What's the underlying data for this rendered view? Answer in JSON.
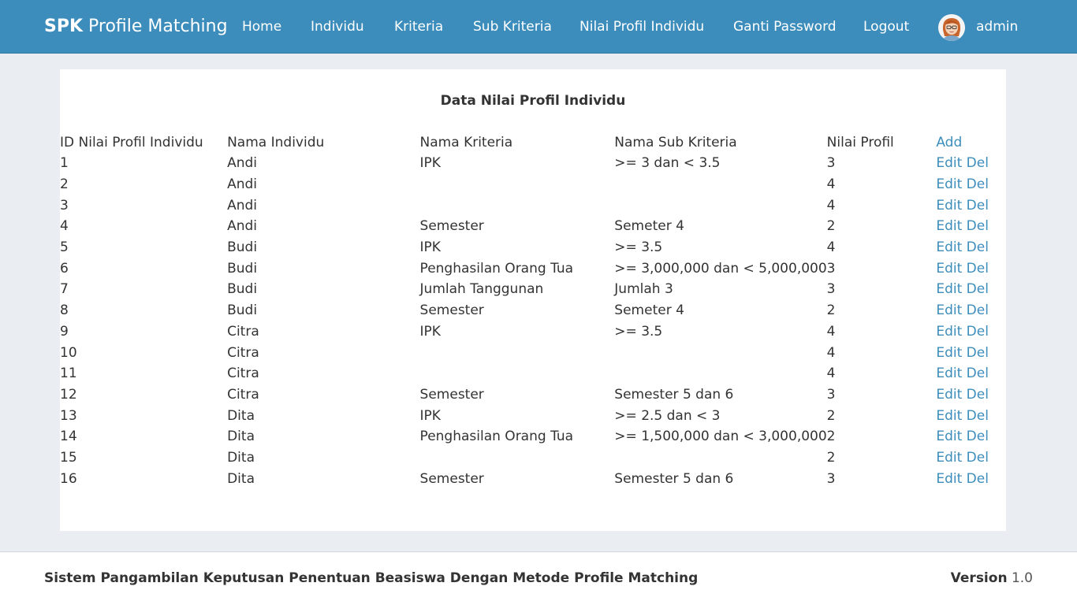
{
  "navbar": {
    "brand_bold": "SPK",
    "brand_rest": " Profile Matching",
    "items": [
      "Home",
      "Individu",
      "Kriteria",
      "Sub Kriteria",
      "Nilai Profil Individu",
      "Ganti Password",
      "Logout"
    ],
    "user": "admin",
    "avatar_icon": "user-avatar-icon"
  },
  "main": {
    "title": "Data Nilai Profil Individu",
    "columns": [
      "ID Nilai Profil Individu",
      "Nama Individu",
      "Nama Kriteria",
      "Nama Sub Kriteria",
      "Nilai Profil",
      "Add"
    ],
    "edit_label": "Edit",
    "del_label": "Del",
    "rows": [
      [
        "1",
        "Andi",
        "IPK",
        ">= 3 dan < 3.5",
        "3"
      ],
      [
        "2",
        "Andi",
        "",
        "",
        "4"
      ],
      [
        "3",
        "Andi",
        "",
        "",
        "4"
      ],
      [
        "4",
        "Andi",
        "Semester",
        "Semeter 4",
        "2"
      ],
      [
        "5",
        "Budi",
        "IPK",
        ">= 3.5",
        "4"
      ],
      [
        "6",
        "Budi",
        "Penghasilan Orang Tua",
        ">= 3,000,000 dan < 5,000,000",
        "3"
      ],
      [
        "7",
        "Budi",
        "Jumlah Tanggunan",
        "Jumlah 3",
        "3"
      ],
      [
        "8",
        "Budi",
        "Semester",
        "Semeter 4",
        "2"
      ],
      [
        "9",
        "Citra",
        "IPK",
        ">= 3.5",
        "4"
      ],
      [
        "10",
        "Citra",
        "",
        "",
        "4"
      ],
      [
        "11",
        "Citra",
        "",
        "",
        "4"
      ],
      [
        "12",
        "Citra",
        "Semester",
        "Semester 5 dan 6",
        "3"
      ],
      [
        "13",
        "Dita",
        "IPK",
        ">= 2.5 dan < 3",
        "2"
      ],
      [
        "14",
        "Dita",
        "Penghasilan Orang Tua",
        ">= 1,500,000 dan < 3,000,000",
        "2"
      ],
      [
        "15",
        "Dita",
        "",
        "",
        "2"
      ],
      [
        "16",
        "Dita",
        "Semester",
        "Semester 5 dan 6",
        "3"
      ]
    ]
  },
  "footer": {
    "left": "Sistem Pangambilan Keputusan Penentuan Beasiswa Dengan Metode Profile Matching",
    "version_label": "Version",
    "version_value": " 1.0"
  },
  "colors": {
    "navbar": "#3c8dbc",
    "link": "#3c8dbc",
    "background": "#eaedf1"
  }
}
